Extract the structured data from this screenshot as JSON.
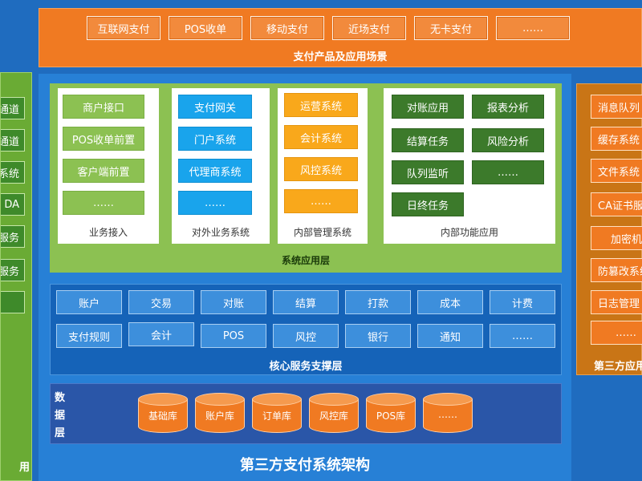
{
  "top": {
    "items": [
      "互联网支付",
      "POS收单",
      "移动支付",
      "近场支付",
      "无卡支付",
      "……"
    ],
    "label": "支付产品及应用场景"
  },
  "left": {
    "items": [
      "通道",
      "通道",
      "系统",
      "DA",
      "服务",
      "服务",
      ""
    ],
    "bottom_label": "用"
  },
  "system_layer": {
    "label": "系统应用层",
    "groups": [
      {
        "caption": "业务接入",
        "items": [
          "商户接口",
          "POS收单前置",
          "客户端前置",
          "……"
        ]
      },
      {
        "caption": "对外业务系统",
        "items": [
          "支付网关",
          "门户系统",
          "代理商系统",
          "……"
        ]
      },
      {
        "caption": "内部管理系统",
        "items": [
          "运营系统",
          "会计系统",
          "风控系统",
          "……"
        ]
      },
      {
        "caption": "内部功能应用",
        "items": [
          "对账应用",
          "报表分析",
          "结算任务",
          "风险分析",
          "队列监听",
          "……",
          "日终任务"
        ]
      }
    ]
  },
  "core_layer": {
    "label": "核心服务支撑层",
    "row1": [
      "账户",
      "交易",
      "对账",
      "结算",
      "打款",
      "成本",
      "计费"
    ],
    "row2": [
      "支付规则",
      "会计",
      "POS",
      "风控",
      "银行",
      "通知",
      "……"
    ]
  },
  "data_layer": {
    "title": "数据层",
    "dbs": [
      "基础库",
      "账户库",
      "订单库",
      "风控库",
      "POS库",
      "……"
    ]
  },
  "bottom_title": "第三方支付系统架构",
  "right": {
    "items": [
      "消息队列",
      "缓存系统",
      "文件系统",
      "CA证书服务",
      "加密机",
      "防篡改系统",
      "日志管理",
      "……"
    ],
    "label": "第三方应用"
  },
  "colors": {
    "orange": "#f07a22",
    "green": "#8cc152",
    "dark_green": "#3c7a2b",
    "blue": "#19a4ec",
    "amber": "#f9a81b",
    "navy": "#1563b8"
  }
}
